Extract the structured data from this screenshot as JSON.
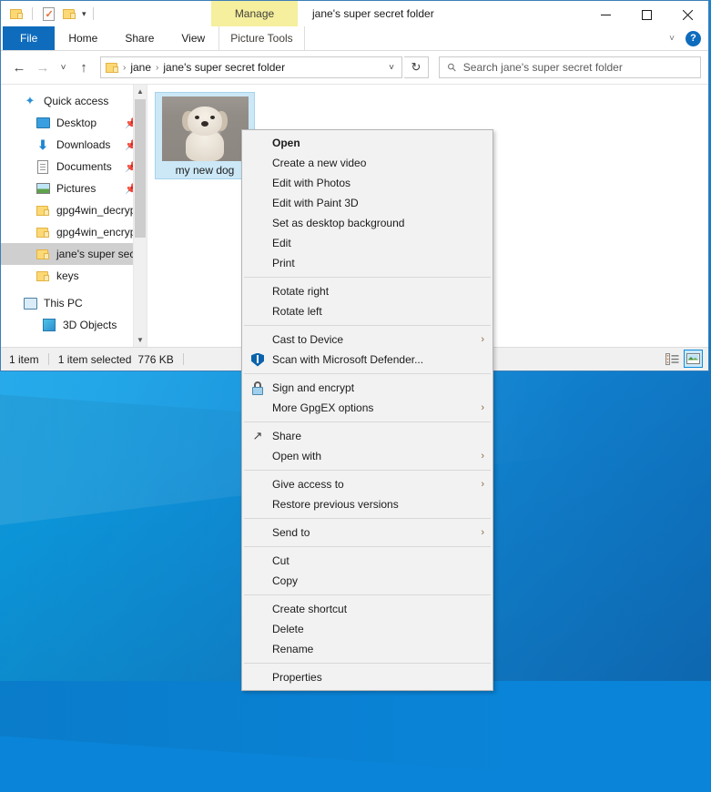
{
  "desktop": {
    "wallpaper_color": "#0d9ee6"
  },
  "window": {
    "title": "jane's super secret folder",
    "contextual_tab_group": "Manage",
    "contextual_tab_subtitle": "Picture Tools",
    "quick_access_toolbar": [
      {
        "name": "folder-icon",
        "tooltip": "Properties folder"
      },
      {
        "name": "properties-icon",
        "tooltip": "Properties"
      },
      {
        "name": "new-folder-icon",
        "tooltip": "New folder"
      },
      {
        "name": "customize-caret-icon",
        "label": "▾"
      }
    ],
    "controls": {
      "minimize": "—",
      "maximize": "□",
      "close": "✕",
      "ribbon_collapse": "˅",
      "help": "?"
    }
  },
  "ribbon": {
    "tabs": [
      {
        "label": "File",
        "active": true
      },
      {
        "label": "Home",
        "active": false
      },
      {
        "label": "Share",
        "active": false
      },
      {
        "label": "View",
        "active": false
      },
      {
        "label": "Picture Tools",
        "active": false
      }
    ]
  },
  "address_bar": {
    "back": "←",
    "forward": "→",
    "recent": "˅",
    "up": "↑",
    "crumbs": [
      "jane",
      "jane's super secret folder"
    ],
    "separator": "›",
    "dropdown_caret": "˅",
    "refresh": "↻"
  },
  "search": {
    "placeholder": "Search jane's super secret folder",
    "icon": "search-icon",
    "value": ""
  },
  "sidebar": {
    "items": [
      {
        "label": "Quick access",
        "icon": "star-icon",
        "indent": 0,
        "pinned": false,
        "selected": false
      },
      {
        "label": "Desktop",
        "icon": "desktop-icon",
        "indent": 1,
        "pinned": true,
        "selected": false
      },
      {
        "label": "Downloads",
        "icon": "download-icon",
        "indent": 1,
        "pinned": true,
        "selected": false
      },
      {
        "label": "Documents",
        "icon": "document-icon",
        "indent": 1,
        "pinned": true,
        "selected": false
      },
      {
        "label": "Pictures",
        "icon": "pictures-icon",
        "indent": 1,
        "pinned": true,
        "selected": false
      },
      {
        "label": "gpg4win_decryp",
        "icon": "folder-icon",
        "indent": 1,
        "pinned": false,
        "selected": false
      },
      {
        "label": "gpg4win_encryp",
        "icon": "folder-icon",
        "indent": 1,
        "pinned": false,
        "selected": false
      },
      {
        "label": "jane's super secr",
        "icon": "folder-icon",
        "indent": 1,
        "pinned": false,
        "selected": true
      },
      {
        "label": "keys",
        "icon": "folder-icon",
        "indent": 1,
        "pinned": false,
        "selected": false
      },
      {
        "label": "This PC",
        "icon": "this-pc-icon",
        "indent": 0,
        "pinned": false,
        "selected": false
      },
      {
        "label": "3D Objects",
        "icon": "3d-objects-icon",
        "indent": 1,
        "pinned": false,
        "selected": false
      }
    ]
  },
  "content": {
    "file": {
      "label": "my new dog",
      "selected": true
    }
  },
  "status_bar": {
    "item_count": "1 item",
    "selection": "1 item selected",
    "size": "776 KB",
    "views": [
      {
        "name": "details-view",
        "active": false
      },
      {
        "name": "large-icons-view",
        "active": true
      }
    ]
  },
  "context_menu": {
    "groups": [
      {
        "items": [
          {
            "label": "Open",
            "bold": true,
            "icon": null,
            "submenu": false
          },
          {
            "label": "Create a new video",
            "bold": false,
            "icon": null,
            "submenu": false
          },
          {
            "label": "Edit with Photos",
            "bold": false,
            "icon": null,
            "submenu": false
          },
          {
            "label": "Edit with Paint 3D",
            "bold": false,
            "icon": null,
            "submenu": false
          },
          {
            "label": "Set as desktop background",
            "bold": false,
            "icon": null,
            "submenu": false
          },
          {
            "label": "Edit",
            "bold": false,
            "icon": null,
            "submenu": false
          },
          {
            "label": "Print",
            "bold": false,
            "icon": null,
            "submenu": false
          }
        ]
      },
      {
        "items": [
          {
            "label": "Rotate right",
            "bold": false,
            "icon": null,
            "submenu": false
          },
          {
            "label": "Rotate left",
            "bold": false,
            "icon": null,
            "submenu": false
          }
        ]
      },
      {
        "items": [
          {
            "label": "Cast to Device",
            "bold": false,
            "icon": null,
            "submenu": true
          },
          {
            "label": "Scan with Microsoft Defender...",
            "bold": false,
            "icon": "shield-icon",
            "submenu": false
          }
        ]
      },
      {
        "items": [
          {
            "label": "Sign and encrypt",
            "bold": false,
            "icon": "lock-icon",
            "submenu": false
          },
          {
            "label": "More GpgEX options",
            "bold": false,
            "icon": null,
            "submenu": true
          }
        ]
      },
      {
        "items": [
          {
            "label": "Share",
            "bold": false,
            "icon": "share-icon",
            "submenu": false
          },
          {
            "label": "Open with",
            "bold": false,
            "icon": null,
            "submenu": true
          }
        ]
      },
      {
        "items": [
          {
            "label": "Give access to",
            "bold": false,
            "icon": null,
            "submenu": true
          },
          {
            "label": "Restore previous versions",
            "bold": false,
            "icon": null,
            "submenu": false
          }
        ]
      },
      {
        "items": [
          {
            "label": "Send to",
            "bold": false,
            "icon": null,
            "submenu": true
          }
        ]
      },
      {
        "items": [
          {
            "label": "Cut",
            "bold": false,
            "icon": null,
            "submenu": false
          },
          {
            "label": "Copy",
            "bold": false,
            "icon": null,
            "submenu": false
          }
        ]
      },
      {
        "items": [
          {
            "label": "Create shortcut",
            "bold": false,
            "icon": null,
            "submenu": false
          },
          {
            "label": "Delete",
            "bold": false,
            "icon": null,
            "submenu": false
          },
          {
            "label": "Rename",
            "bold": false,
            "icon": null,
            "submenu": false
          }
        ]
      },
      {
        "items": [
          {
            "label": "Properties",
            "bold": false,
            "icon": null,
            "submenu": false
          }
        ]
      }
    ],
    "submenu_arrow": "›"
  }
}
